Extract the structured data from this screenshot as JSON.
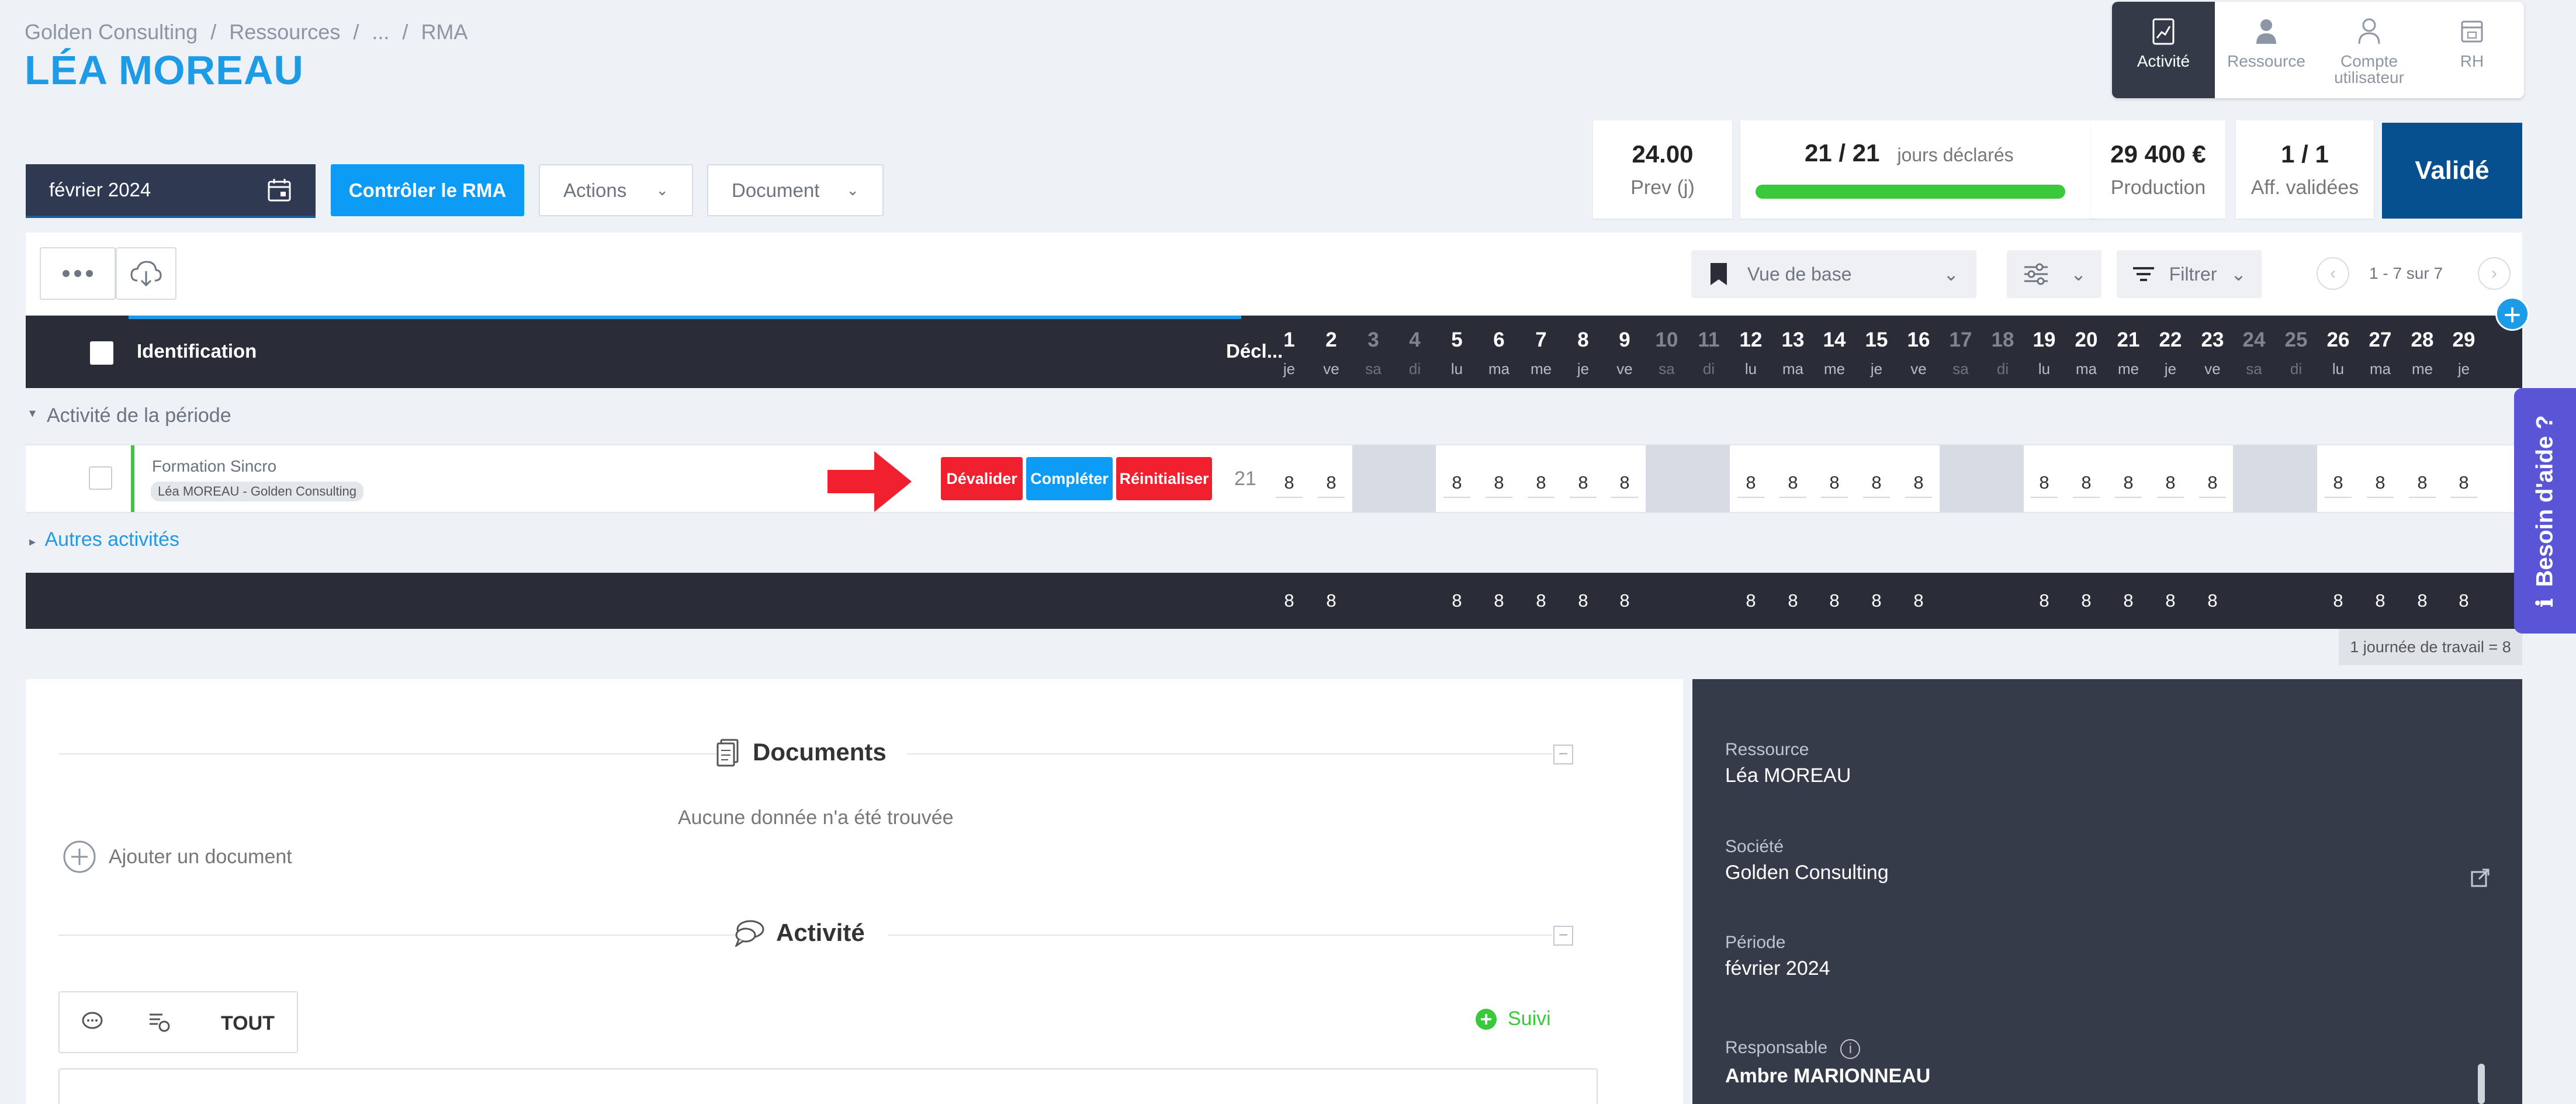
{
  "breadcrumb": [
    "Golden Consulting",
    "/",
    "Ressources",
    "/",
    "...",
    "/",
    "RMA"
  ],
  "page_title": "LÉA MOREAU",
  "topnav": [
    {
      "label": "Activité",
      "icon": "activity-chart-icon",
      "active": true
    },
    {
      "label": "Ressource",
      "icon": "resource-person-icon",
      "active": false
    },
    {
      "label": "Compte utilisateur",
      "icon": "user-account-icon",
      "active": false
    },
    {
      "label": "RH",
      "icon": "hr-calendar-icon",
      "active": false
    }
  ],
  "month_selector": "février 2024",
  "buttons": {
    "control": "Contrôler le RMA",
    "actions": "Actions",
    "document": "Document"
  },
  "kpis": {
    "prev_value": "24.00",
    "prev_label": "Prev (j)",
    "days_value": "21 / 21",
    "days_label": "jours déclarés",
    "days_progress": 1.0,
    "production_value": "29 400 €",
    "production_label": "Production",
    "aff_value": "1 / 1",
    "aff_label": "Aff. validées",
    "status": "Validé"
  },
  "toolbar": {
    "view": "Vue de base",
    "filter": "Filtrer",
    "pagination": "1 - 7 sur 7"
  },
  "grid": {
    "col_identification": "Identification",
    "col_declared": "Décl...",
    "days": [
      {
        "n": "1",
        "d": "je",
        "we": false
      },
      {
        "n": "2",
        "d": "ve",
        "we": false
      },
      {
        "n": "3",
        "d": "sa",
        "we": true
      },
      {
        "n": "4",
        "d": "di",
        "we": true
      },
      {
        "n": "5",
        "d": "lu",
        "we": false
      },
      {
        "n": "6",
        "d": "ma",
        "we": false
      },
      {
        "n": "7",
        "d": "me",
        "we": false
      },
      {
        "n": "8",
        "d": "je",
        "we": false
      },
      {
        "n": "9",
        "d": "ve",
        "we": false
      },
      {
        "n": "10",
        "d": "sa",
        "we": true
      },
      {
        "n": "11",
        "d": "di",
        "we": true
      },
      {
        "n": "12",
        "d": "lu",
        "we": false
      },
      {
        "n": "13",
        "d": "ma",
        "we": false
      },
      {
        "n": "14",
        "d": "me",
        "we": false
      },
      {
        "n": "15",
        "d": "je",
        "we": false
      },
      {
        "n": "16",
        "d": "ve",
        "we": false
      },
      {
        "n": "17",
        "d": "sa",
        "we": true
      },
      {
        "n": "18",
        "d": "di",
        "we": true
      },
      {
        "n": "19",
        "d": "lu",
        "we": false
      },
      {
        "n": "20",
        "d": "ma",
        "we": false
      },
      {
        "n": "21",
        "d": "me",
        "we": false
      },
      {
        "n": "22",
        "d": "je",
        "we": false
      },
      {
        "n": "23",
        "d": "ve",
        "we": false
      },
      {
        "n": "24",
        "d": "sa",
        "we": true
      },
      {
        "n": "25",
        "d": "di",
        "we": true
      },
      {
        "n": "26",
        "d": "lu",
        "we": false
      },
      {
        "n": "27",
        "d": "ma",
        "we": false
      },
      {
        "n": "28",
        "d": "me",
        "we": false
      },
      {
        "n": "29",
        "d": "je",
        "we": false
      }
    ],
    "section_label": "Activité de la période",
    "row": {
      "name": "Formation Sincro",
      "tag": "Léa MOREAU - Golden Consulting",
      "declared": "21",
      "values": [
        "8",
        "8",
        "",
        "",
        "8",
        "8",
        "8",
        "8",
        "8",
        "",
        "",
        "8",
        "8",
        "8",
        "8",
        "8",
        "",
        "",
        "8",
        "8",
        "8",
        "8",
        "8",
        "",
        "",
        "8",
        "8",
        "8",
        "8"
      ]
    },
    "row_actions": {
      "devalider": "Dévalider",
      "completer": "Compléter",
      "reinitialiser": "Réinitialiser"
    },
    "other_label": "Autres activités",
    "totals": [
      "8",
      "8",
      "",
      "",
      "8",
      "8",
      "8",
      "8",
      "8",
      "",
      "",
      "8",
      "8",
      "8",
      "8",
      "8",
      "",
      "",
      "8",
      "8",
      "8",
      "8",
      "8",
      "",
      "",
      "8",
      "8",
      "8",
      "8"
    ],
    "work_day_note": "1 journée de travail = 8"
  },
  "documents": {
    "title": "Documents",
    "empty": "Aucune donnée n'a été trouvée",
    "add": "Ajouter un document"
  },
  "activity": {
    "title": "Activité",
    "tab_all": "TOUT",
    "follow": "Suivi"
  },
  "details": {
    "resource_label": "Ressource",
    "resource_value": "Léa MOREAU",
    "company_label": "Société",
    "company_value": "Golden Consulting",
    "period_label": "Période",
    "period_value": "février 2024",
    "manager_label": "Responsable",
    "manager_value": "Ambre MARIONNEAU"
  },
  "help": "Besoin d'aide ?",
  "colors": {
    "primary": "#0d9cf5",
    "dark": "#2a2c38",
    "valide": "#07508f",
    "danger": "#f0202e",
    "success": "#3ac93a",
    "help": "#5a55d6"
  }
}
